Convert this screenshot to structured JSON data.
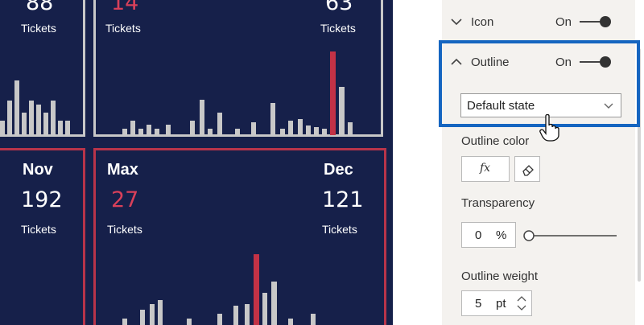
{
  "dashboard": {
    "top_left": {
      "value": "88",
      "label": "Tickets"
    },
    "top_mid": {
      "value": "14",
      "label": "Tickets"
    },
    "top_right": {
      "value": "63",
      "label": "Tickets"
    },
    "bottom_left": {
      "month": "Nov",
      "value": "192",
      "label": "Tickets"
    },
    "bottom_mid": {
      "month": "Max",
      "value": "27",
      "label": "Tickets"
    },
    "bottom_right": {
      "month": "Dec",
      "value": "121",
      "label": "Tickets"
    },
    "colors": {
      "background": "#16204a",
      "bar": "#c8c8c8",
      "highlight": "#c33246",
      "card_border_white": "#c8c8c8",
      "card_border_red": "#b8344a"
    }
  },
  "panel": {
    "icon_section": {
      "label": "Icon",
      "state": "On"
    },
    "outline_section": {
      "label": "Outline",
      "state": "On"
    },
    "state_select": {
      "value": "Default state"
    },
    "outline_color": {
      "label": "Outline color",
      "fx_label": "fx"
    },
    "transparency": {
      "label": "Transparency",
      "value": "0",
      "unit": "%",
      "level": 0
    },
    "outline_weight": {
      "label": "Outline weight",
      "value": "5",
      "unit": "pt"
    },
    "colors": {
      "highlight_border": "#1565c0",
      "panel_bg": "#f4f2ef"
    }
  }
}
